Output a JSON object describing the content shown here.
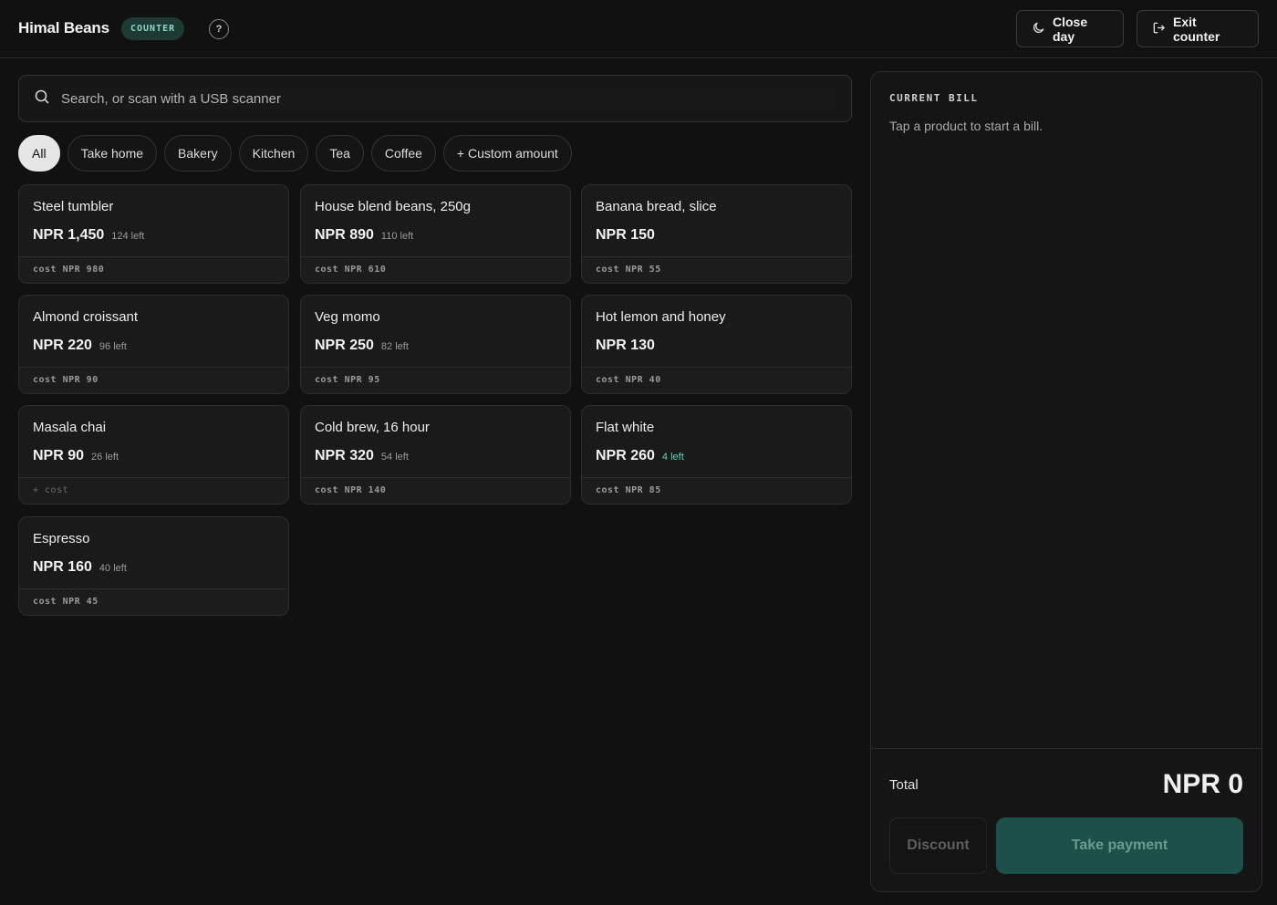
{
  "header": {
    "brand": "Himal Beans",
    "mode_badge": "COUNTER",
    "help_label": "?",
    "close_day_label": "Close day",
    "exit_label": "Exit counter"
  },
  "search": {
    "placeholder": "Search, or scan with a USB scanner",
    "value": ""
  },
  "categories": [
    {
      "label": "All",
      "active": true
    },
    {
      "label": "Take home",
      "active": false
    },
    {
      "label": "Bakery",
      "active": false
    },
    {
      "label": "Kitchen",
      "active": false
    },
    {
      "label": "Tea",
      "active": false
    },
    {
      "label": "Coffee",
      "active": false
    },
    {
      "label": "+ Custom amount",
      "active": false
    }
  ],
  "products": [
    {
      "name": "Steel tumbler",
      "price": "NPR 1,450",
      "stock": "124 left",
      "cost": "cost NPR 980"
    },
    {
      "name": "House blend beans, 250g",
      "price": "NPR 890",
      "stock": "110 left",
      "cost": "cost NPR 610"
    },
    {
      "name": "Banana bread, slice",
      "price": "NPR 150",
      "stock": "",
      "cost": "cost NPR 55"
    },
    {
      "name": "Almond croissant",
      "price": "NPR 220",
      "stock": "96 left",
      "cost": "cost NPR 90"
    },
    {
      "name": "Veg momo",
      "price": "NPR 250",
      "stock": "82 left",
      "cost": "cost NPR 95"
    },
    {
      "name": "Hot lemon and honey",
      "price": "NPR 130",
      "stock": "",
      "cost": "cost NPR 40"
    },
    {
      "name": "Masala chai",
      "price": "NPR 90",
      "stock": "26 left",
      "cost": "+ cost"
    },
    {
      "name": "Cold brew, 16 hour",
      "price": "NPR 320",
      "stock": "54 left",
      "cost": "cost NPR 140"
    },
    {
      "name": "Flat white",
      "price": "NPR 260",
      "stock": "4 left",
      "cost": "cost NPR 85"
    },
    {
      "name": "Espresso",
      "price": "NPR 160",
      "stock": "40 left",
      "cost": "cost NPR 45"
    }
  ],
  "bill": {
    "title": "CURRENT BILL",
    "empty_message": "Tap a product to start a bill.",
    "total_label": "Total",
    "total_value": "NPR 0",
    "discount_label": "Discount",
    "pay_label": "Take payment"
  },
  "colors": {
    "accent": "#1d5048",
    "low_stock": "#5fd3b0",
    "badge_bg": "#1d3a35",
    "badge_text": "#8fd6c4"
  }
}
